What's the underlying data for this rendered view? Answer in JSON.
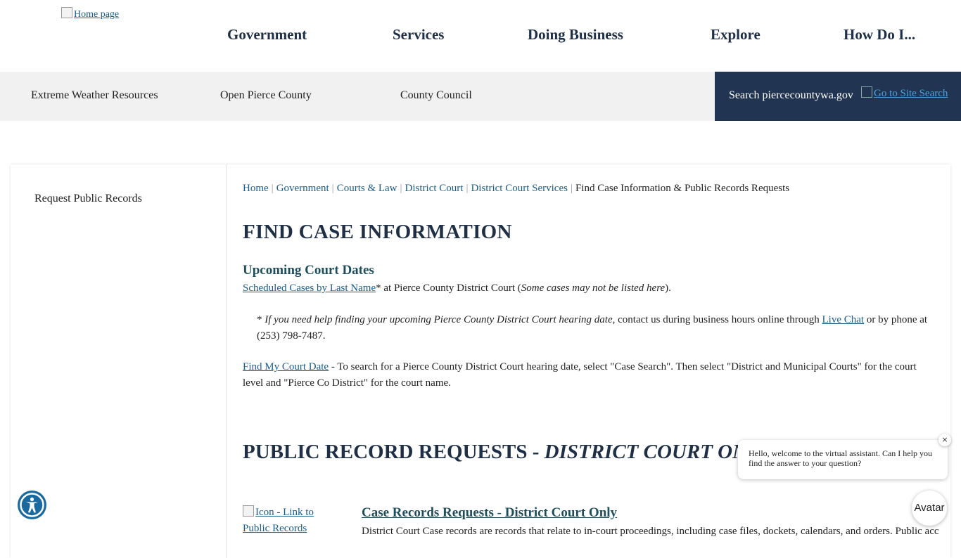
{
  "header": {
    "logo_alt": "Home page",
    "nav": [
      "Government",
      "Services",
      "Doing Business",
      "Explore",
      "How Do I..."
    ]
  },
  "utility": {
    "items": [
      "Extreme Weather Resources",
      "Open Pierce County",
      "County Council"
    ],
    "search_label": "Search piercecountywa.gov",
    "search_go": "Go to Site Search"
  },
  "sidebar": {
    "items": [
      "Request Public Records"
    ]
  },
  "breadcrumb": {
    "links": [
      "Home",
      "Government",
      "Courts & Law",
      "District Court",
      "District Court Services"
    ],
    "current": "Find Case Information & Public Records Requests"
  },
  "content": {
    "title": "FIND CASE INFORMATION",
    "upcoming_heading": "Upcoming Court Dates",
    "scheduled_link": "Scheduled Cases by Last Name",
    "scheduled_suffix": "* at Pierce County District Court (",
    "scheduled_note": "Some cases may not be listed here",
    "scheduled_end": ").",
    "help_star": "* ",
    "help_italic": "If you need help finding your upcoming Pierce County District Court hearing date",
    "help_mid": ", contact us during business hours online through ",
    "live_chat": "Live Chat",
    "help_end": " or by phone at (253) 798-7487.",
    "find_link": "Find My Court Date",
    "find_text": " - To search for a Pierce County District Court hearing date, select \"Case Search\".  Then select \"District and Municipal Courts\" for the court level and \"Pierce Co District\" for the court name.",
    "title2_plain": "PUBLIC RECORD REQUESTS - ",
    "title2_italic": "DISTRICT COURT ONLY",
    "icon_alt": "Icon - Link to Public Records",
    "case_heading": "Case Records Requests - District Court Only",
    "case_text": "District Court Case records are records that relate to in-court proceedings, including case files, dockets, calendars, and orders. Public access"
  },
  "chat": {
    "message": "Hello, welcome to the virtual assistant. Can I help you find the answer to your question?",
    "close": "×",
    "avatar": "Avatar"
  }
}
